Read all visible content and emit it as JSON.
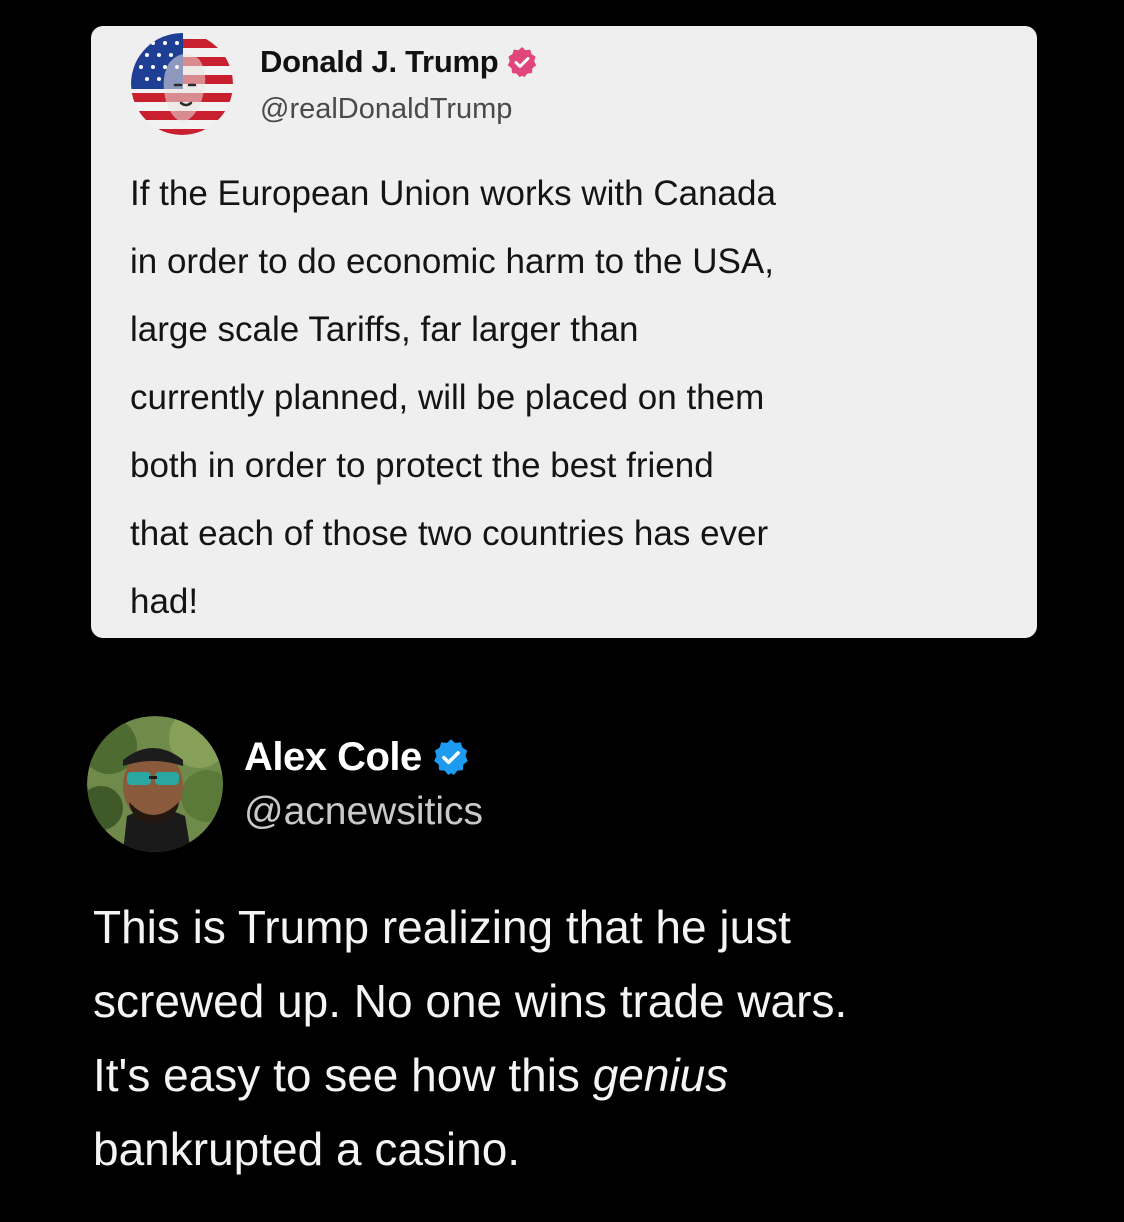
{
  "quoted_post": {
    "author_name": "Donald J. Trump",
    "handle": "@realDonaldTrump",
    "verified_color": "#e0457b",
    "avatar_icon": "flag-portrait-avatar",
    "text_lines": [
      "If the European Union works with Canada",
      "in order to do economic harm to the USA,",
      "large scale Tariffs, far larger than",
      "currently planned, will be placed on them",
      "both in order to protect the best friend",
      "that each of those two countries has ever",
      "had!"
    ]
  },
  "reply_post": {
    "author_name": "Alex Cole",
    "handle": "@acnewsitics",
    "verified_color": "#1d9bf0",
    "avatar_icon": "man-sunglasses-avatar",
    "text_line_1": "This is Trump realizing that he just",
    "text_line_2": "screwed up. No one wins trade wars.",
    "text_line_3_before": "It's easy to see how this ",
    "text_line_3_emphasis": "genius",
    "text_line_4": "bankrupted a casino."
  }
}
